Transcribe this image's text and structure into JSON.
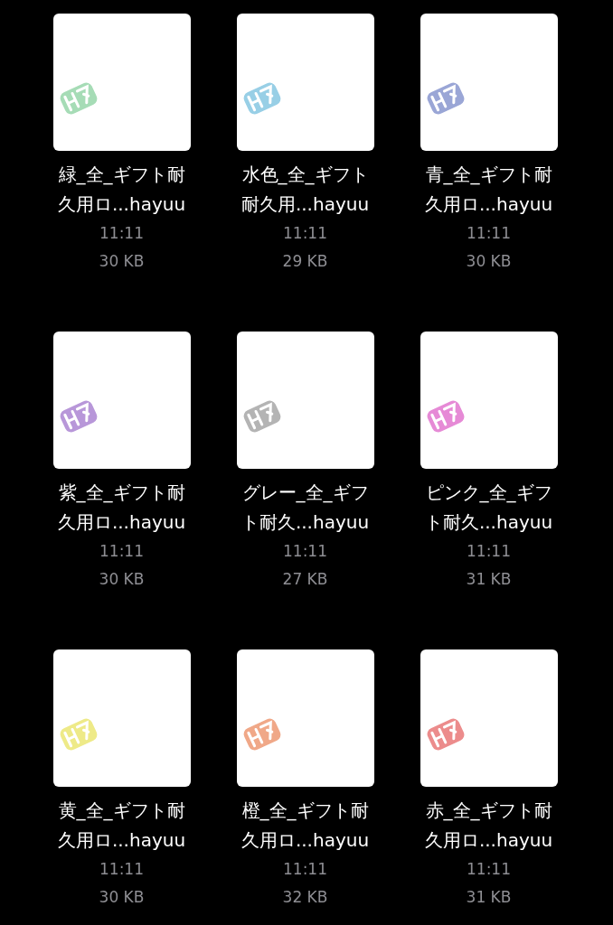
{
  "files": [
    {
      "name_lines": [
        "緑_全_ギフト耐",
        "久用ロ...hayuu"
      ],
      "time": "11:11",
      "size": "30 KB",
      "color": "#a6dcb6"
    },
    {
      "name_lines": [
        "水色_全_ギフト",
        "耐久用...hayuu"
      ],
      "time": "11:11",
      "size": "29 KB",
      "color": "#98cfe6"
    },
    {
      "name_lines": [
        "青_全_ギフト耐",
        "久用ロ...hayuu"
      ],
      "time": "11:11",
      "size": "30 KB",
      "color": "#9aa6d6"
    },
    {
      "name_lines": [
        "紫_全_ギフト耐",
        "久用ロ...hayuu"
      ],
      "time": "11:11",
      "size": "30 KB",
      "color": "#b897d9"
    },
    {
      "name_lines": [
        "グレー_全_ギフ",
        "ト耐久...hayuu"
      ],
      "time": "11:11",
      "size": "27 KB",
      "color": "#b4b4b4"
    },
    {
      "name_lines": [
        "ピンク_全_ギフ",
        "ト耐久...hayuu"
      ],
      "time": "11:11",
      "size": "31 KB",
      "color": "#e68ad6"
    },
    {
      "name_lines": [
        "黄_全_ギフト耐",
        "久用ロ...hayuu"
      ],
      "time": "11:11",
      "size": "30 KB",
      "color": "#eeea88"
    },
    {
      "name_lines": [
        "橙_全_ギフト耐",
        "久用ロ...hayuu"
      ],
      "time": "11:11",
      "size": "32 KB",
      "color": "#f0a888"
    },
    {
      "name_lines": [
        "赤_全_ギフト耐",
        "久用ロ...hayuu"
      ],
      "time": "11:11",
      "size": "31 KB",
      "color": "#ec8c8c"
    }
  ]
}
